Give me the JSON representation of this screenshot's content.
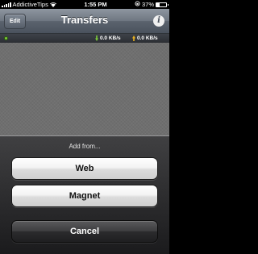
{
  "status_bar": {
    "carrier": "AddictiveTips",
    "time": "1:55 PM",
    "battery_text": "37%",
    "battery_level": 0.37
  },
  "nav_bar": {
    "edit_label": "Edit",
    "title": "Transfers",
    "info_label": "i"
  },
  "speed_bar": {
    "download_speed": "0.0 KB/s",
    "upload_speed": "0.0 KB/s",
    "status_color": "#7bc93a",
    "download_arrow_color": "#7bc93a",
    "upload_arrow_color": "#e8b020"
  },
  "action_sheet": {
    "title": "Add from...",
    "buttons": {
      "web": "Web",
      "magnet": "Magnet",
      "cancel": "Cancel"
    }
  }
}
